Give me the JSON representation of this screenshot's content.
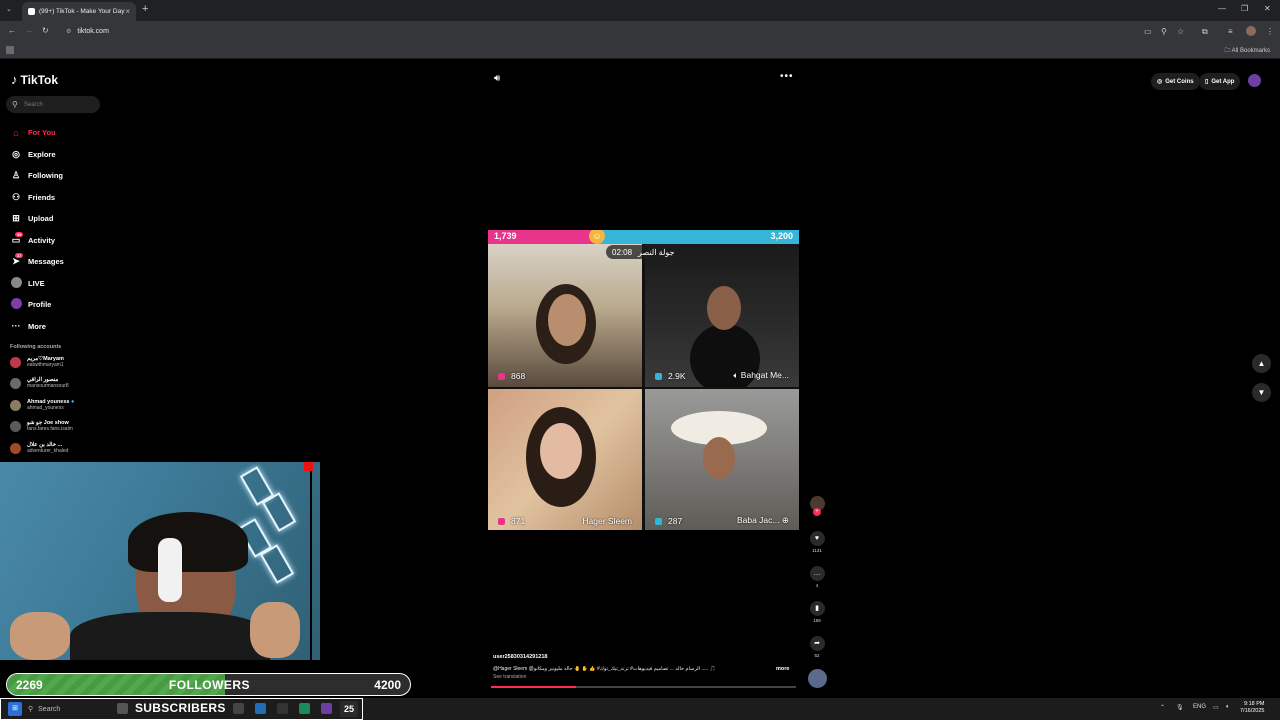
{
  "browser": {
    "tab_title": "(99+) TikTok - Make Your Day",
    "url": "tiktok.com",
    "all_bookmarks": "All Bookmarks"
  },
  "brand": {
    "name": "TikTok"
  },
  "search": {
    "placeholder": "Search"
  },
  "nav": {
    "items": [
      {
        "label": "For You",
        "icon": "home-icon",
        "active": true
      },
      {
        "label": "Explore",
        "icon": "compass-icon"
      },
      {
        "label": "Following",
        "icon": "user-follow-icon"
      },
      {
        "label": "Friends",
        "icon": "friends-icon"
      },
      {
        "label": "Upload",
        "icon": "upload-icon"
      },
      {
        "label": "Activity",
        "icon": "activity-icon",
        "badge": "99"
      },
      {
        "label": "Messages",
        "icon": "messages-icon",
        "badge": "37"
      },
      {
        "label": "LIVE",
        "icon": "live-icon"
      },
      {
        "label": "Profile",
        "icon": "profile-icon"
      },
      {
        "label": "More",
        "icon": "more-icon"
      }
    ]
  },
  "following": {
    "heading": "Following accounts",
    "accounts": [
      {
        "name": "مريم♡Maryam",
        "handle": "eatwithmaryam1",
        "color": "#c0394b"
      },
      {
        "name": "منصور الراقي",
        "handle": "mansourmansour8",
        "color": "#6b6b6b"
      },
      {
        "name": "Ahmad youness",
        "handle": "ahmad_youness",
        "color": "#8a7a66"
      },
      {
        "name": "جو شو Joe show",
        "handle": "fans.fares.fans.isalm",
        "color": "#5a5a5a"
      },
      {
        "name": "خالد بن علال ...",
        "handle": "adventurer_khaled",
        "color": "#a04a2c"
      }
    ]
  },
  "header": {
    "get_coins": "Get Coins",
    "get_app": "Get App"
  },
  "video": {
    "pk_left_score": "1,739",
    "pk_right_score": "3,200",
    "pk_left_share": 0.35,
    "timer": "02:08",
    "round_label": "جولة النصر",
    "cells": [
      {
        "stat": "868",
        "name": "",
        "dot": "#e8348a"
      },
      {
        "stat": "2.9K",
        "name": "Bahgat Me...",
        "dot": "#35b6d8"
      },
      {
        "stat": "871",
        "name": "Hager Sleem",
        "dot": "#e8348a"
      },
      {
        "stat": "287",
        "name": "Baba Jac...",
        "dot": "#35b6d8"
      }
    ]
  },
  "actions": {
    "likes": "1131",
    "comments": "4",
    "saves": "159",
    "shares": "52"
  },
  "caption": {
    "user": "user2583031429121​8",
    "text": "@Hager Sleem @الرسام خالد ... تصاميم فيديوهات# ترند_تيك_توك# 👍 ✋ 🤚 حاله مليونير ومكانو ..... 🎵",
    "more": "more",
    "see_translation": "See translation",
    "progress": 0.28
  },
  "overlay": {
    "followers_current": "2269",
    "followers_label": "FOLLOWERS",
    "followers_goal": "4200",
    "followers_progress": 0.54,
    "subscribers_label": "SUBSCRIBERS",
    "subscribers_count": "25"
  },
  "taskbar": {
    "search_placeholder": "Search",
    "lang": "ENG",
    "time": "9:18 PM",
    "date": "7/16/2025"
  }
}
